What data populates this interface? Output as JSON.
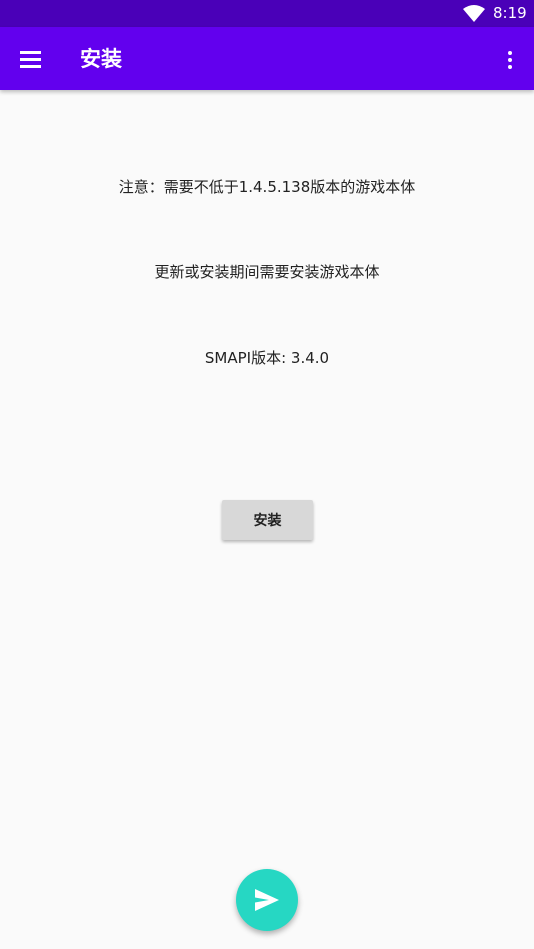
{
  "status_bar": {
    "time": "8:19",
    "wifi_icon": "wifi-icon"
  },
  "app_bar": {
    "title": "安装",
    "menu_icon": "hamburger-menu-icon",
    "overflow_icon": "more-vert-icon",
    "color": "#6200ee"
  },
  "main": {
    "notice": "注意：需要不低于1.4.5.138版本的游戏本体",
    "update_note": "更新或安装期间需要安装游戏本体",
    "smapi_version": "SMAPI版本: 3.4.0",
    "install_button_label": "安装"
  },
  "fab": {
    "icon": "send-icon",
    "color": "#26d7c3"
  }
}
